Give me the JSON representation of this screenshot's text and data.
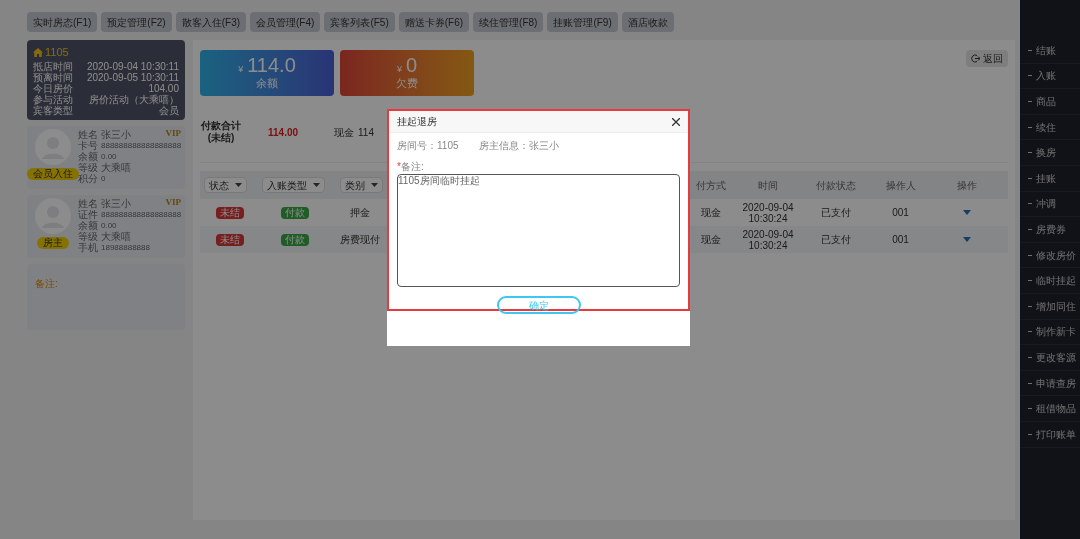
{
  "tabs": [
    {
      "label": "实时房态(F1)",
      "selected": false
    },
    {
      "label": "预定管理(F2)",
      "selected": false
    },
    {
      "label": "散客入住(F3)",
      "selected": false
    },
    {
      "label": "会员管理(F4)",
      "selected": false
    },
    {
      "label": "宾客列表(F5)",
      "selected": false
    },
    {
      "label": "赠送卡券(F6)",
      "selected": false
    },
    {
      "label": "续住管理(F8)",
      "selected": false
    },
    {
      "label": "挂账管理(F9)",
      "selected": false
    },
    {
      "label": "酒店收款",
      "selected": false
    }
  ],
  "room_card": {
    "room": "1105",
    "rows": [
      {
        "label": "抵店时间",
        "value": "2020-09-04 10:30:11"
      },
      {
        "label": "预离时间",
        "value": "2020-09-05 10:30:11"
      },
      {
        "label": "今日房价",
        "value": "104.00"
      },
      {
        "label": "参与活动",
        "value": "房价活动（大乘嘻）"
      },
      {
        "label": "宾客类型",
        "value": "会员"
      }
    ]
  },
  "guests": [
    {
      "badge": "VIP",
      "tag": "会员入住",
      "fields": [
        {
          "label": "姓名",
          "value": "张三小",
          "kind": "text"
        },
        {
          "label": "卡号",
          "value": "888888888888888888",
          "kind": "number"
        },
        {
          "label": "余额",
          "value": "0.00",
          "kind": "number"
        },
        {
          "label": "等级",
          "value": "大乘嘻",
          "kind": "text"
        },
        {
          "label": "积分",
          "value": "0",
          "kind": "number"
        }
      ]
    },
    {
      "badge": "VIP",
      "tag": "房主",
      "fields": [
        {
          "label": "姓名",
          "value": "张三小",
          "kind": "text"
        },
        {
          "label": "证件",
          "value": "888888888888888888",
          "kind": "number"
        },
        {
          "label": "余额",
          "value": "0.00",
          "kind": "number"
        },
        {
          "label": "等级",
          "value": "大乘嘻",
          "kind": "text"
        },
        {
          "label": "手机",
          "value": "18988888888",
          "kind": "number"
        }
      ]
    }
  ],
  "notes": {
    "label": "备注:"
  },
  "summary_cards": [
    {
      "kind": "balance",
      "currency": "¥",
      "amount": "114.0",
      "label": "余额"
    },
    {
      "kind": "debt",
      "currency": "¥",
      "amount": "0",
      "label": "欠费"
    }
  ],
  "back_button": "返回",
  "payment_total": {
    "label": "付款合计\n(未结)",
    "amount": "114.00",
    "method": "现金",
    "method_amount": "114"
  },
  "filters": [
    "状态",
    "入账类型",
    "类别"
  ],
  "columns": [
    "付方式",
    "时间",
    "付款状态",
    "操作人",
    "操作"
  ],
  "rows": [
    {
      "status": "未结",
      "type": "付款",
      "category": "押金",
      "method": "现金",
      "time": "2020-09-04\n10:30:24",
      "pay_status": "已支付",
      "operator": "001"
    },
    {
      "status": "未结",
      "type": "付款",
      "category": "房费现付",
      "method": "现金",
      "time": "2020-09-04\n10:30:24",
      "pay_status": "已支付",
      "operator": "001"
    }
  ],
  "actions": [
    "结账",
    "入账",
    "商品",
    "续住",
    "换房",
    "挂账",
    "冲调",
    "房费券",
    "修改房价",
    "临时挂起",
    "增加同住",
    "制作新卡",
    "更改客源",
    "申请查房",
    "租借物品",
    "打印账单"
  ],
  "dialog": {
    "title": "挂起退房",
    "room_label": "房间号：",
    "room": "1105",
    "owner_label": "房主信息：",
    "owner": "张三小",
    "required_mark": "*",
    "notes_label": "备注:",
    "notes_value": "1105房间临时挂起",
    "confirm": "确定"
  }
}
